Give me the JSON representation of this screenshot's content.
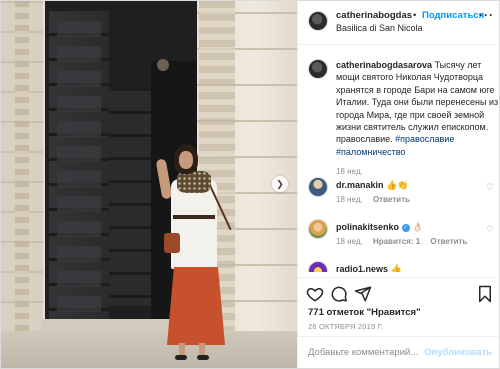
{
  "header": {
    "username": "catherinabogdas",
    "separator": "•",
    "follow_label": "Подписаться",
    "location": "Basilica di San Nicola",
    "more_label": "···"
  },
  "caption": {
    "username": "catherinabogdasarova",
    "text": "Тысячу лет мощи святого Николая Чудотворца хранятся в городе Бари на самом юге Италии. Туда они были перенесены из города Мира, где при своей земной жизни святитель служил епископом. православие.",
    "hashtags": "#православие #паломничество",
    "time": "18 нед."
  },
  "comments": [
    {
      "username": "dr.manakin",
      "text": "👍👏",
      "time": "18 нед.",
      "likes": "",
      "reply": "Ответить"
    },
    {
      "username": "polinakitsenko",
      "text": "👌🏻",
      "time": "18 нед.",
      "likes": "Нравится: 1",
      "reply": "Ответить"
    },
    {
      "username": "radio1.news",
      "text": "👍",
      "time": "",
      "likes": "",
      "reply": ""
    }
  ],
  "actions": {
    "like_icon": "heart-icon",
    "comment_icon": "comment-icon",
    "share_icon": "share-icon",
    "save_icon": "bookmark-icon"
  },
  "likes_text": "771 отметок \"Нравится\"",
  "date": "26 ОКТЯБРЯ 2019 Г.",
  "add_comment": {
    "placeholder": "Добавьте комментарий...",
    "post_label": "Опубликовать"
  },
  "colors": {
    "link_blue": "#0095f6",
    "hashtag_blue": "#00376b",
    "muted_gray": "#8e8e8e",
    "post_disabled": "#b3dbff"
  }
}
